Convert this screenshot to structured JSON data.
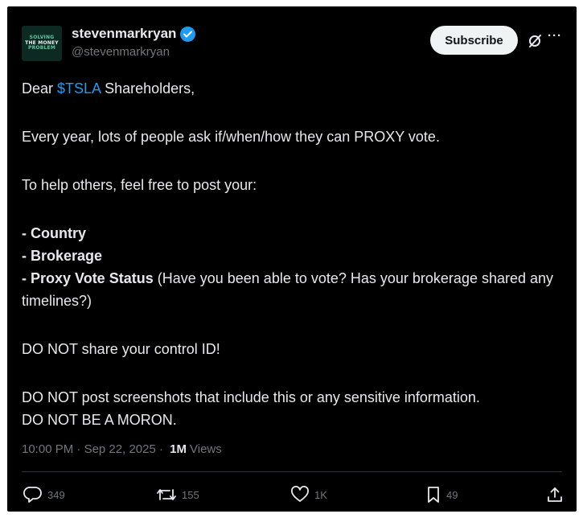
{
  "author": {
    "avatar_lines": [
      "SOLVING",
      "THE MONEY",
      "PROBLEM"
    ],
    "display_name": "stevenmarkryan",
    "handle": "@stevenmarkryan"
  },
  "header": {
    "subscribe_label": "Subscribe",
    "grok_icon": "grok-icon",
    "more_icon": "more-icon"
  },
  "post": {
    "greeting_prefix": "Dear ",
    "cashtag": "$TSLA",
    "greeting_suffix": " Shareholders,",
    "line_ask": "Every year, lots of people ask if/when/how they can PROXY vote.",
    "line_help": "To help others, feel free to post your:",
    "item_country": "- Country",
    "item_brokerage": "- Brokerage",
    "item_proxy_bold": "- Proxy Vote Status",
    "item_proxy_rest": " (Have you been able to vote? Has your brokerage shared any timelines?)",
    "warning_control_id": "DO NOT share your control ID!",
    "warning_screenshots": "DO NOT post screenshots that include this or any sensitive information.",
    "warning_moron": "DO NOT BE A MORON."
  },
  "meta": {
    "time": "10:00 PM",
    "separator": " · ",
    "date": "Sep 22, 2025",
    "separator2": " · ",
    "views_count": "1M",
    "views_label": "Views"
  },
  "actions": {
    "replies": "349",
    "reposts": "155",
    "likes": "1K",
    "bookmarks": "49"
  },
  "colors": {
    "background": "#000000",
    "text": "#e7e9ea",
    "muted": "#71767b",
    "link": "#1d9bf0",
    "verified": "#1d9bf0",
    "subscribe_bg": "#eff3f4"
  }
}
